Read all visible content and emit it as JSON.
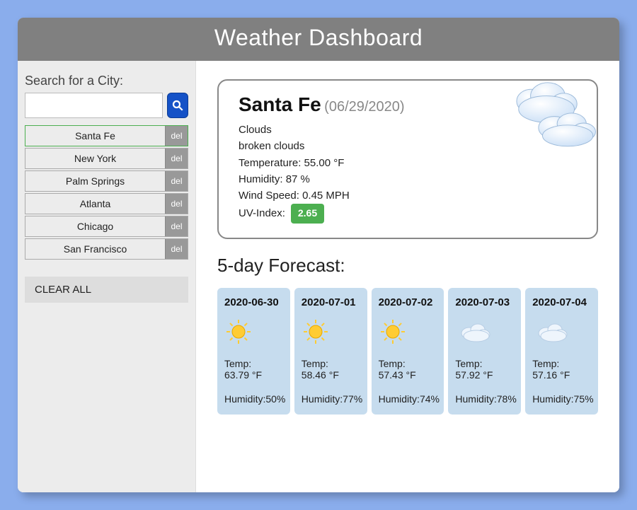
{
  "header": {
    "title": "Weather Dashboard"
  },
  "sidebar": {
    "search_label": "Search for a City:",
    "search_value": "",
    "search_placeholder": "",
    "del_label": "del",
    "clear_all_label": "CLEAR ALL",
    "history": [
      {
        "name": "Santa Fe",
        "active": true
      },
      {
        "name": "New York",
        "active": false
      },
      {
        "name": "Palm Springs",
        "active": false
      },
      {
        "name": "Atlanta",
        "active": false
      },
      {
        "name": "Chicago",
        "active": false
      },
      {
        "name": "San Francisco",
        "active": false
      }
    ]
  },
  "current": {
    "city": "Santa Fe",
    "date": "(06/29/2020)",
    "condition_main": "Clouds",
    "condition_desc": "broken clouds",
    "temp_label": "Temperature: ",
    "temp_value": "55.00 °F",
    "humidity_label": "Humidity: ",
    "humidity_value": "87 %",
    "wind_label": "Wind Speed: ",
    "wind_value": "0.45 MPH",
    "uv_label": "UV-Index:",
    "uv_value": "2.65",
    "uv_color": "#4caf50"
  },
  "forecast": {
    "title": "5-day Forecast:",
    "temp_label": "Temp:",
    "humidity_label_prefix": "Humidity:",
    "days": [
      {
        "date": "2020-06-30",
        "icon": "sun",
        "temp": "63.79 °F",
        "humidity": "50%"
      },
      {
        "date": "2020-07-01",
        "icon": "sun",
        "temp": "58.46 °F",
        "humidity": "77%"
      },
      {
        "date": "2020-07-02",
        "icon": "sun",
        "temp": "57.43 °F",
        "humidity": "74%"
      },
      {
        "date": "2020-07-03",
        "icon": "cloud",
        "temp": "57.92 °F",
        "humidity": "78%"
      },
      {
        "date": "2020-07-04",
        "icon": "cloud",
        "temp": "57.16 °F",
        "humidity": "75%"
      }
    ]
  },
  "icons": {
    "search": "search-icon",
    "sun": "sun-icon",
    "cloud": "cloud-icon",
    "big_cloud": "big-cloud-icon"
  }
}
